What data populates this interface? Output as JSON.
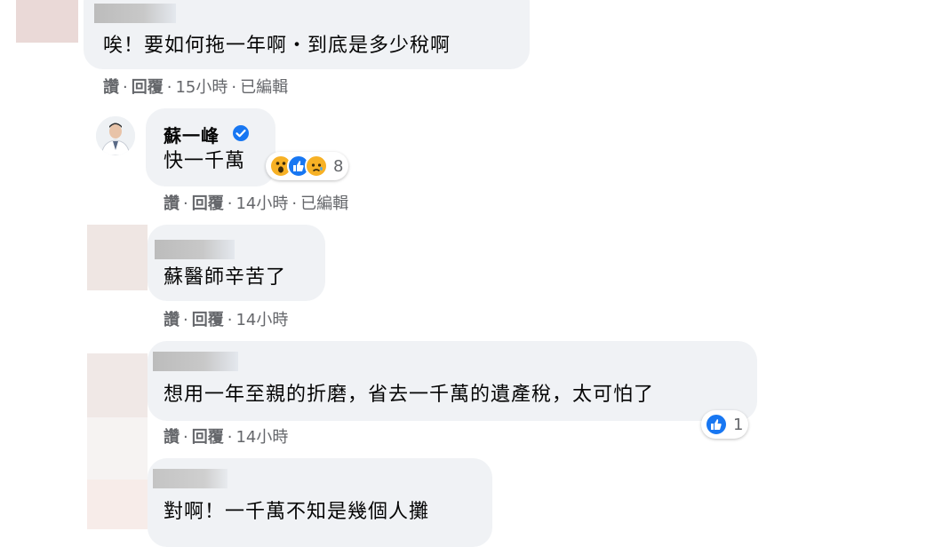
{
  "comments": [
    {
      "text": "唉！要如何拖一年啊・到底是多少稅啊",
      "actions": [
        "讚",
        "回覆",
        "15小時",
        "已編輯"
      ]
    },
    {
      "author": "蘇一峰",
      "text": "快一千萬",
      "reaction_count": "8",
      "reaction_icons": [
        "wow-icon",
        "like-icon",
        "sad-icon"
      ],
      "actions": [
        "讚",
        "回覆",
        "14小時",
        "已編輯"
      ]
    },
    {
      "text": "蘇醫師辛苦了",
      "actions": [
        "讚",
        "回覆",
        "14小時"
      ]
    },
    {
      "text": "想用一年至親的折磨，省去一千萬的遺產稅，太可怕了",
      "reaction_count": "1",
      "reaction_icons": [
        "like-icon"
      ],
      "actions": [
        "讚",
        "回覆",
        "14小時"
      ]
    },
    {
      "text": "對啊！一千萬不知是幾個人攤"
    }
  ],
  "colors": {
    "bubble": "#f0f2f5",
    "meta": "#65676b",
    "verified": "#1877f2",
    "like": "#1877f2",
    "wow_sad": "#f7b125"
  }
}
